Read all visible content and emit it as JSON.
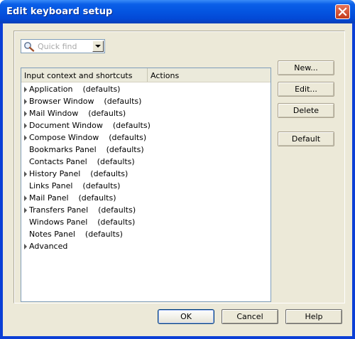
{
  "window": {
    "title": "Edit keyboard setup"
  },
  "search": {
    "placeholder": "Quick find"
  },
  "table": {
    "columns": [
      "Input context and shortcuts",
      "Actions"
    ],
    "rows": [
      {
        "label": "Application    (defaults)",
        "expandable": true
      },
      {
        "label": "Browser Window    (defaults)",
        "expandable": true
      },
      {
        "label": "Mail Window    (defaults)",
        "expandable": true
      },
      {
        "label": "Document Window    (defaults)",
        "expandable": true
      },
      {
        "label": "Compose Window    (defaults)",
        "expandable": true
      },
      {
        "label": "Bookmarks Panel    (defaults)",
        "expandable": false
      },
      {
        "label": "Contacts Panel    (defaults)",
        "expandable": false
      },
      {
        "label": "History Panel    (defaults)",
        "expandable": true
      },
      {
        "label": "Links Panel    (defaults)",
        "expandable": false
      },
      {
        "label": "Mail Panel    (defaults)",
        "expandable": true
      },
      {
        "label": "Transfers Panel    (defaults)",
        "expandable": true
      },
      {
        "label": "Windows Panel    (defaults)",
        "expandable": false
      },
      {
        "label": "Notes Panel    (defaults)",
        "expandable": false
      },
      {
        "label": "Advanced",
        "expandable": true
      }
    ]
  },
  "side_buttons": {
    "new": "New...",
    "edit": "Edit...",
    "delete": "Delete",
    "default": "Default"
  },
  "footer": {
    "ok": "OK",
    "cancel": "Cancel",
    "help": "Help"
  }
}
